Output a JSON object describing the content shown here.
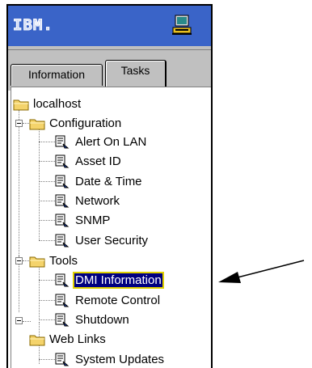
{
  "header": {
    "logo_text": "IBM.",
    "computer_icon": "computer-icon",
    "brand_color": "#3a64c8"
  },
  "tabs": [
    {
      "label": "Information",
      "selected": false
    },
    {
      "label": "Tasks",
      "selected": true
    }
  ],
  "tree": {
    "root": "localhost",
    "groups": [
      {
        "label": "Configuration",
        "expanded": true,
        "items": [
          "Alert On LAN",
          "Asset ID",
          "Date & Time",
          "Network",
          "SNMP",
          "User Security"
        ]
      },
      {
        "label": "Tools",
        "expanded": true,
        "items": [
          "DMI Information",
          "Remote Control",
          "Shutdown"
        ]
      },
      {
        "label": "Web Links",
        "expanded": true,
        "items": [
          "System Updates"
        ]
      }
    ],
    "selected_item": "DMI Information",
    "selection_color": "#000080"
  },
  "annotation": {
    "arrow_icon": "callout-arrow-icon"
  }
}
